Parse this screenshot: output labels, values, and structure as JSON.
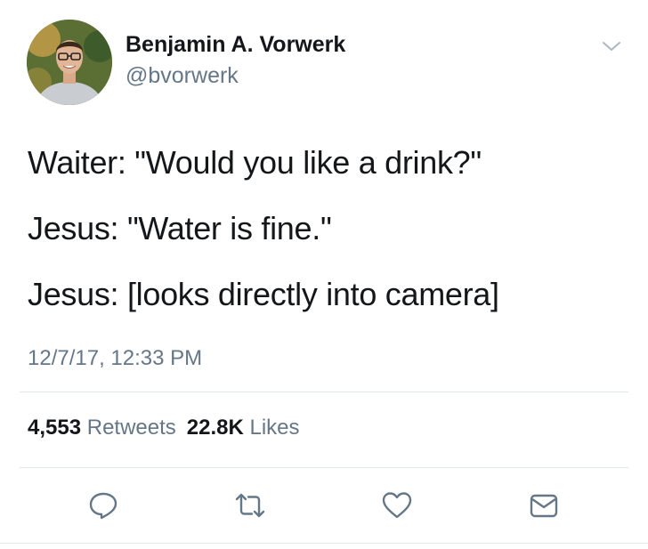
{
  "author": {
    "display_name": "Benjamin A. Vorwerk",
    "handle": "@bvorwerk"
  },
  "tweet": {
    "lines": [
      "Waiter: \"Would you like a drink?\"",
      "Jesus: \"Water is fine.\"",
      "Jesus: [looks directly into camera]"
    ],
    "timestamp": "12/7/17, 12:33 PM"
  },
  "stats": {
    "retweets_count": "4,553",
    "retweets_label": "Retweets",
    "likes_count": "22.8K",
    "likes_label": "Likes"
  },
  "actions": [
    "reply-icon",
    "retweet-icon",
    "like-icon",
    "direct-message-icon"
  ],
  "colors": {
    "text": "#14171a",
    "secondary": "#657786",
    "divider": "#e1e8ed",
    "icon": "#657786"
  }
}
